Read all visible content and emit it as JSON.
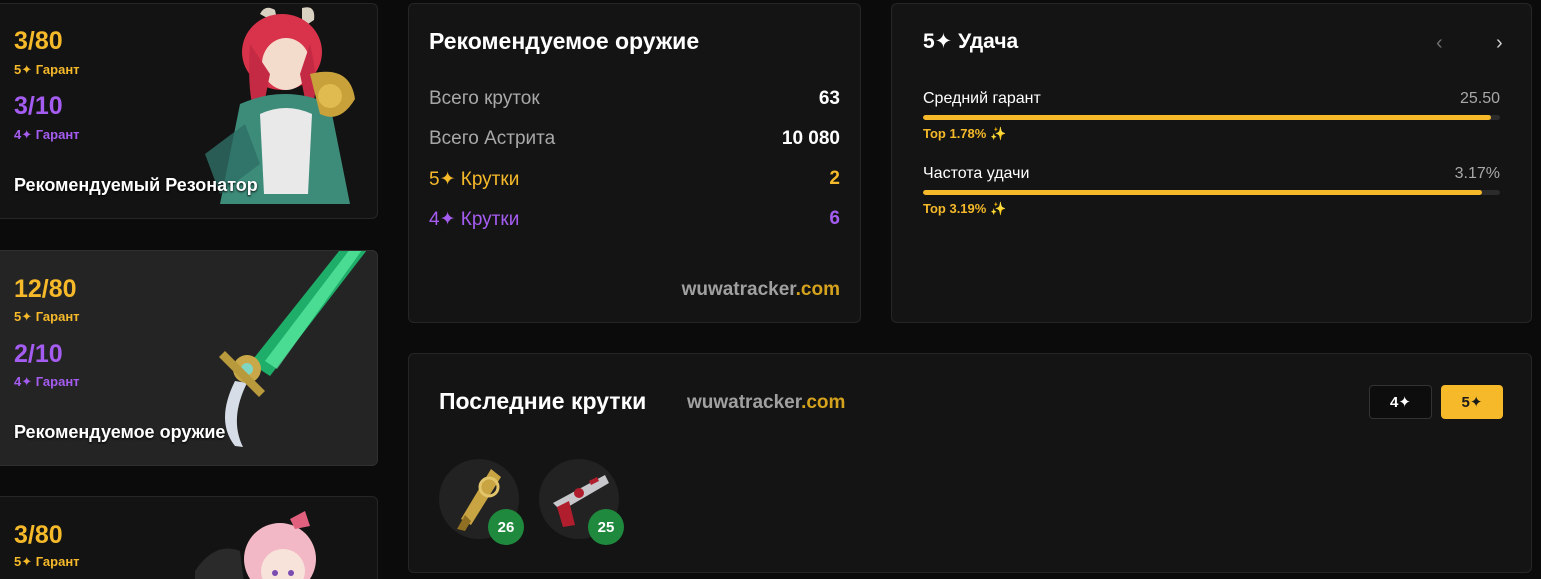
{
  "banners": [
    {
      "pity5": "3/80",
      "label5": "5✦ Гарант",
      "pity4": "3/10",
      "label4": "4✦ Гарант",
      "title": "Рекомендуемый Резонатор"
    },
    {
      "pity5": "12/80",
      "label5": "5✦ Гарант",
      "pity4": "2/10",
      "label4": "4✦ Гарант",
      "title": "Рекомендуемое оружие"
    },
    {
      "pity5": "3/80",
      "label5": "5✦ Гарант"
    }
  ],
  "weapon_card": {
    "title": "Рекомендуемое оружие",
    "rows": [
      {
        "label": "Всего круток",
        "value": "63"
      },
      {
        "label": "Всего Астрита",
        "value": "10 080"
      },
      {
        "label": "5✦ Крутки",
        "value": "2"
      },
      {
        "label": "4✦ Крутки",
        "value": "6"
      }
    ],
    "watermark_main": "wuwatracker",
    "watermark_tld": ".com"
  },
  "luck_card": {
    "title": "5✦ Удача",
    "prev_icon": "‹",
    "next_icon": "›",
    "metrics": [
      {
        "name": "Средний гарант",
        "value": "25.50",
        "top": "Top 1.78% ✨",
        "bar_percent": 98.5
      },
      {
        "name": "Частота удачи",
        "value": "3.17%",
        "top": "Top 3.19% ✨",
        "bar_percent": 96.9
      }
    ]
  },
  "recent_card": {
    "title": "Последние крутки",
    "watermark_main": "wuwatracker",
    "watermark_tld": ".com",
    "filter_4": "4✦",
    "filter_5": "5✦",
    "pulls": [
      {
        "icon": "golden-rifle-icon",
        "count": "26"
      },
      {
        "icon": "red-pistol-icon",
        "count": "25"
      }
    ]
  },
  "colors": {
    "gold": "#f5b92a",
    "purple": "#a55cf0",
    "badge_green": "#1f8a3e"
  }
}
